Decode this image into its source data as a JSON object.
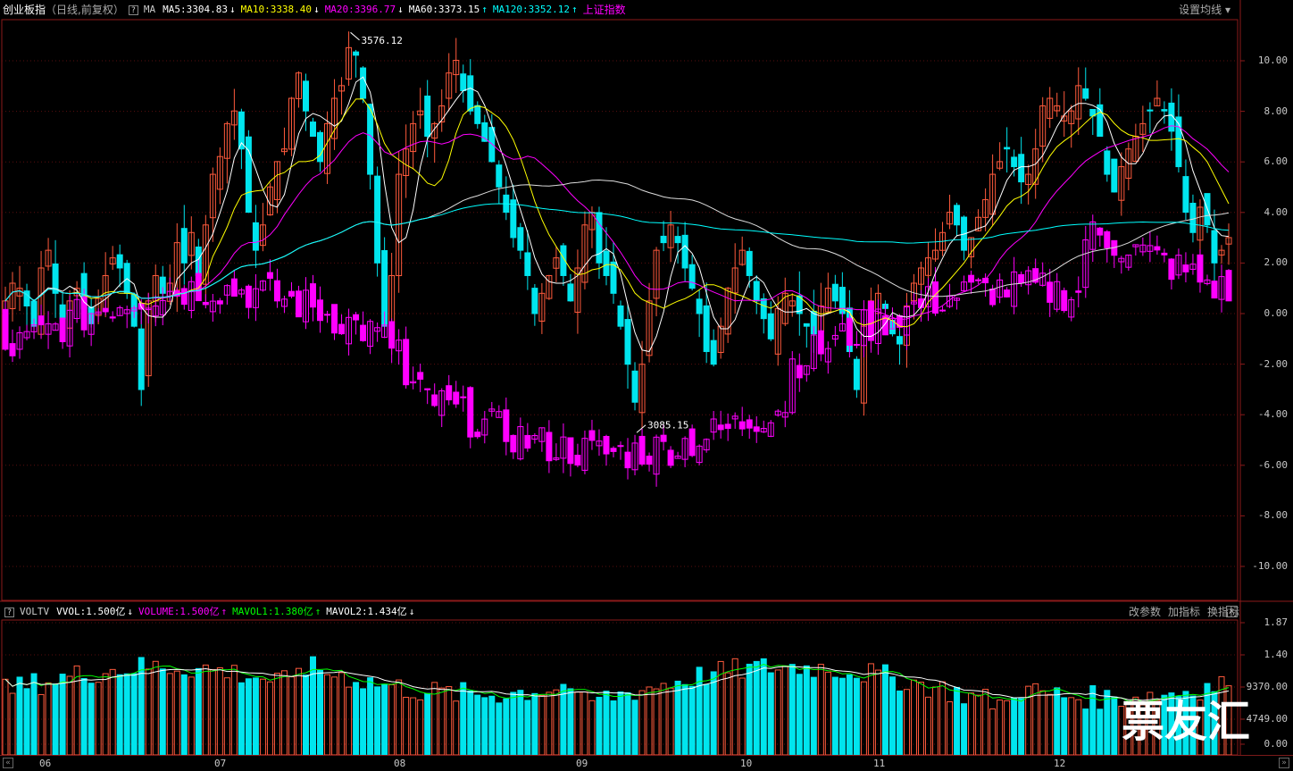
{
  "main_header": {
    "title": "创业板指",
    "subtitle": "（日线,前复权）",
    "help": "?",
    "ma_label": "MA",
    "items": [
      {
        "text": "MA5:3304.83",
        "arrow": "↓",
        "color": "#ffffff",
        "arrow_color": "#ffffff"
      },
      {
        "text": "MA10:3338.40",
        "arrow": "↓",
        "color": "#ffff00",
        "arrow_color": "#ffffff"
      },
      {
        "text": "MA20:3396.77",
        "arrow": "↓",
        "color": "#ff00ff",
        "arrow_color": "#ffffff"
      },
      {
        "text": "MA60:3373.15",
        "arrow": "↑",
        "color": "#ffffff",
        "arrow_color": "#00ffff"
      },
      {
        "text": "MA120:3352.12",
        "arrow": "↑",
        "color": "#00ffff",
        "arrow_color": "#00ffff"
      }
    ],
    "overlay_name": "上证指数",
    "overlay_color": "#ff00ff",
    "settings": "设置均线 ▾"
  },
  "vol_header": {
    "help": "?",
    "name": "VOLTV",
    "items": [
      {
        "text": "VVOL:1.500亿",
        "arrow": "↓",
        "color": "#ffffff"
      },
      {
        "text": "VOLUME:1.500亿",
        "arrow": "↑",
        "color": "#ff00ff"
      },
      {
        "text": "MAVOL1:1.380亿",
        "arrow": "↑",
        "color": "#00ff00"
      },
      {
        "text": "MAVOL2:1.434亿",
        "arrow": "↓",
        "color": "#ffffff"
      }
    ],
    "actions": [
      "改参数",
      "加指标",
      "换指标"
    ],
    "close": "✕"
  },
  "y_axis_main": [
    "10.00",
    "8.00",
    "6.00",
    "4.00",
    "2.00",
    "0.00",
    "-2.00",
    "-4.00",
    "-6.00",
    "-8.00",
    "-10.00"
  ],
  "y_axis_vol": [
    "1.87",
    "1.40",
    "9370.00",
    "4749.00",
    "0.00"
  ],
  "x_axis": [
    "06",
    "07",
    "08",
    "09",
    "10",
    "11",
    "12"
  ],
  "annotations": {
    "high": "3576.12",
    "low": "3085.15"
  },
  "watermark": "票友汇",
  "colors": {
    "up": "#ff5a3c",
    "down": "#00e5ee",
    "overlay": "#ff00ff",
    "grid": "#5a0e0e",
    "frame": "#8b1a1a"
  },
  "chart_data": {
    "type": "candlestick",
    "ylim": [
      -10,
      10
    ],
    "y_unit": "%",
    "x_ticks": [
      "06",
      "07",
      "08",
      "09",
      "10",
      "11",
      "12"
    ],
    "high_label": "3576.12",
    "low_label": "3085.15",
    "series": [
      {
        "name": "创业板指",
        "kind": "candle"
      },
      {
        "name": "上证指数",
        "kind": "candle-overlay"
      },
      {
        "name": "MA5",
        "kind": "line"
      },
      {
        "name": "MA10",
        "kind": "line"
      },
      {
        "name": "MA20",
        "kind": "line"
      },
      {
        "name": "MA60",
        "kind": "line"
      },
      {
        "name": "MA120",
        "kind": "line"
      },
      {
        "name": "VOLUME",
        "kind": "volume-bar"
      },
      {
        "name": "MAVOL1",
        "kind": "line"
      },
      {
        "name": "MAVOL2",
        "kind": "line"
      }
    ],
    "closes_pct": [
      0.5,
      1.2,
      1.0,
      0.3,
      -0.5,
      1.8,
      2.5,
      0.8,
      -0.2,
      0.5,
      1.0,
      0.2,
      -0.4,
      0.6,
      1.5,
      2.2,
      1.8,
      0.8,
      -0.5,
      -3.0,
      0.5,
      1.5,
      0.8,
      1.2,
      2.8,
      2.0,
      3.2,
      1.5,
      3.5,
      5.5,
      6.2,
      7.5,
      8.0,
      6.5,
      4.0,
      2.5,
      3.5,
      5.0,
      6.0,
      6.5,
      8.5,
      9.5,
      8.0,
      7.0,
      6.0,
      7.5,
      8.5,
      9.0,
      10.5,
      10.2,
      8.5,
      5.5,
      2.0,
      -0.5,
      1.5,
      5.5,
      6.5,
      7.5,
      8.0,
      7.0,
      7.5,
      8.2,
      9.5,
      10.0,
      8.8,
      8.0,
      7.5,
      6.8,
      6.0,
      5.0,
      4.0,
      3.0,
      2.5,
      1.5,
      0.0,
      0.8,
      1.5,
      2.2,
      1.5,
      0.5,
      1.8,
      3.5,
      4.0,
      2.0,
      1.5,
      0.8,
      -0.5,
      -2.0,
      -3.5,
      -2.0,
      0.5,
      2.5,
      2.8,
      3.5,
      2.8,
      1.8,
      1.0,
      0.0,
      -1.5,
      -2.0,
      -0.5,
      1.0,
      1.8,
      2.5,
      1.5,
      0.5,
      -0.2,
      -1.0,
      0.2,
      0.8,
      0.5,
      0.0,
      -0.5,
      -0.8,
      0.3,
      1.0,
      0.5,
      0.0,
      -1.5,
      -3.0,
      -0.5,
      0.5,
      0.8,
      0.2,
      -0.8,
      -1.2,
      0.3,
      1.2,
      1.8,
      2.2,
      2.5,
      3.2,
      4.0,
      3.5,
      2.5,
      3.0,
      3.8,
      4.5,
      5.5,
      6.0,
      6.5,
      5.8,
      5.2,
      5.5,
      6.5,
      8.2,
      8.5,
      8.2,
      7.8,
      8.0,
      9.0,
      8.5,
      7.8,
      7.0,
      5.5,
      4.8,
      5.8,
      6.5,
      7.0,
      7.5,
      8.0,
      8.5,
      8.0,
      7.2,
      5.8,
      4.0,
      3.2,
      4.2,
      3.5,
      2.0,
      2.5,
      3.0
    ]
  }
}
